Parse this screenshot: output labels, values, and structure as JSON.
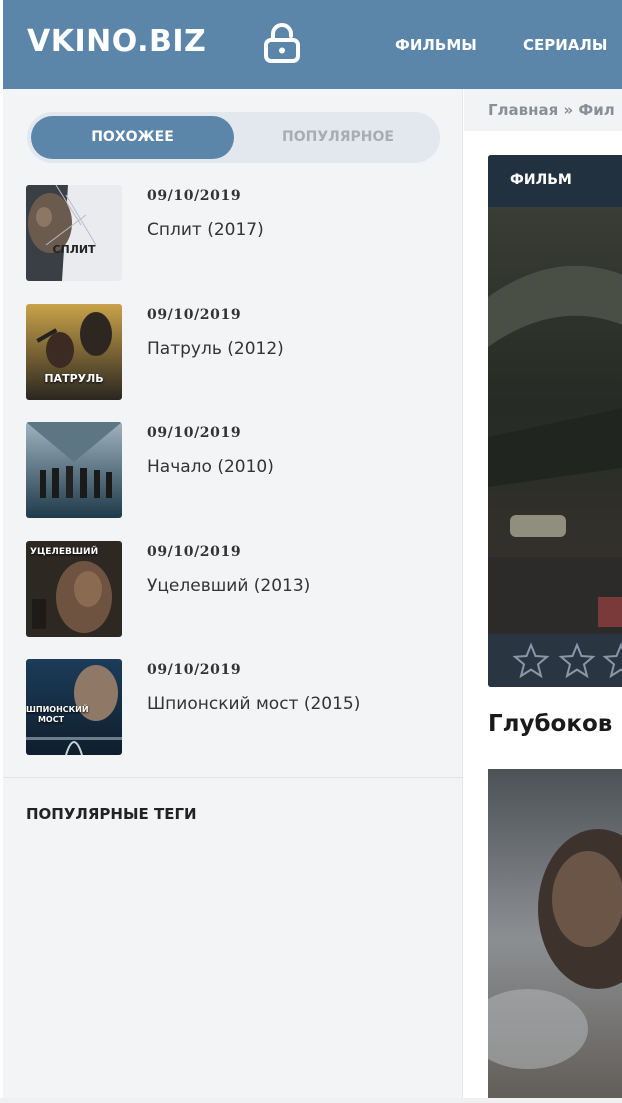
{
  "header": {
    "logo": "VKINO.BIZ",
    "lock_icon": "unlock-icon",
    "nav": [
      "ФИЛЬМЫ",
      "СЕРИАЛЫ"
    ]
  },
  "sidebar": {
    "tabs": {
      "active": "ПОХОЖЕЕ",
      "inactive": "ПОПУЛЯРНОЕ"
    },
    "items": [
      {
        "date": "09/10/2019",
        "title": "Сплит (2017)",
        "poster_text": "СПЛИТ"
      },
      {
        "date": "09/10/2019",
        "title": "Патруль (2012)",
        "poster_text": "ПАТРУЛЬ"
      },
      {
        "date": "09/10/2019",
        "title": "Начало (2010)",
        "poster_text": ""
      },
      {
        "date": "09/10/2019",
        "title": "Уцелевший (2013)",
        "poster_text": "УЦЕЛЕВШИЙ"
      },
      {
        "date": "09/10/2019",
        "title": "Шпионский мост (2015)",
        "poster_text": "ШПИОНСКИЙ МОСТ"
      }
    ],
    "tags_heading": "ПОПУЛЯРНЫЕ ТЕГИ"
  },
  "main": {
    "breadcrumb": "Главная » Фил",
    "card_badge": "ФИЛЬМ",
    "headline": "Глубоков"
  },
  "colors": {
    "accent": "#5b86aa",
    "sidebar_bg": "#f3f4f6",
    "card_dark": "#1f2b38"
  }
}
